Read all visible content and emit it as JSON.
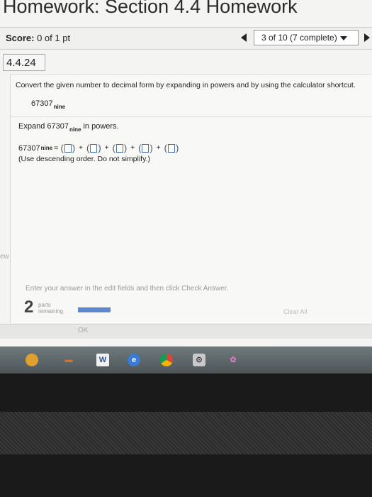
{
  "page": {
    "title": "Homework: Section 4.4 Homework"
  },
  "score_bar": {
    "score_label": "Score:",
    "score_value": "0 of 1 pt",
    "progress": "3 of 10 (7 complete)"
  },
  "question": {
    "number": "4.4.24",
    "prompt": "Convert the given number to decimal form by expanding in powers and by using the calculator shortcut.",
    "given_number": "67307",
    "given_base": "nine",
    "expand_prefix": "Expand 67307",
    "expand_base": "nine",
    "expand_suffix": "in powers.",
    "answer_number": "67307",
    "answer_base": "nine",
    "equals": "=",
    "plus": "+",
    "instruction": "(Use descending order. Do not simplify.)"
  },
  "sidebar": {
    "partial_label": "ew"
  },
  "footer": {
    "enter_message": "Enter your answer in the edit fields and then click Check Answer.",
    "parts_count": "2",
    "parts_line1": "parts",
    "parts_line2": "remaining",
    "parts_remaining_fraction": 0.33,
    "clear_all_label": "Clear All",
    "ok_label": "OK"
  },
  "taskbar": {
    "word_icon_letter": "W",
    "icons": [
      "firefox-icon",
      "cursor-icon",
      "word-icon",
      "edge-icon",
      "chrome-icon",
      "network-icon",
      "flower-icon"
    ]
  },
  "colors": {
    "accent": "#5b88cf",
    "input_border": "#4a78b5"
  }
}
